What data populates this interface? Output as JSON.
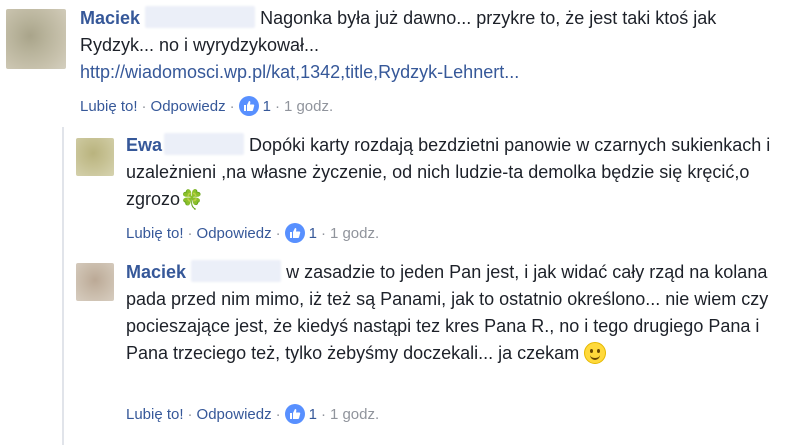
{
  "comments": [
    {
      "author": "Maciek",
      "text": "Nagonka była już dawno... przykre to, że jest taki ktoś jak Rydzyk... no i wyrydzykował...",
      "link": "http://wiadomosci.wp.pl/kat,1342,title,Rydzyk-Lehnert...",
      "actions": {
        "like": "Lubię to!",
        "reply": "Odpowiedz",
        "like_count": "1",
        "time": "1 godz."
      }
    },
    {
      "author": "Ewa",
      "text": "Dopóki karty rozdają bezdzietni panowie w czarnych sukienkach i uzależnieni ,na własne życzenie, od nich ludzie-ta demolka będzie się kręcić,o zgrozo",
      "emoji": "four-leaf-clover",
      "actions": {
        "like": "Lubię to!",
        "reply": "Odpowiedz",
        "like_count": "1",
        "time": "1 godz."
      }
    },
    {
      "author": "Maciek",
      "text": "w zasadzie to jeden Pan jest, i jak widać cały rząd na kolana pada przed nim mimo, iż też są Panami, jak to ostatnio określono... nie wiem czy pocieszające jest, że kiedyś nastąpi tez kres Pana R., no i tego drugiego Pana i Pana trzeciego też, tylko żebyśmy doczekali... ja czekam",
      "emoji": "smiling-face",
      "actions": {
        "like": "Lubię to!",
        "reply": "Odpowiedz",
        "like_count": "1",
        "time": "1 godz."
      }
    }
  ],
  "colors": {
    "name": "#365899",
    "text": "#1d2129",
    "meta": "#90949c",
    "like_badge": "#5890ff"
  }
}
